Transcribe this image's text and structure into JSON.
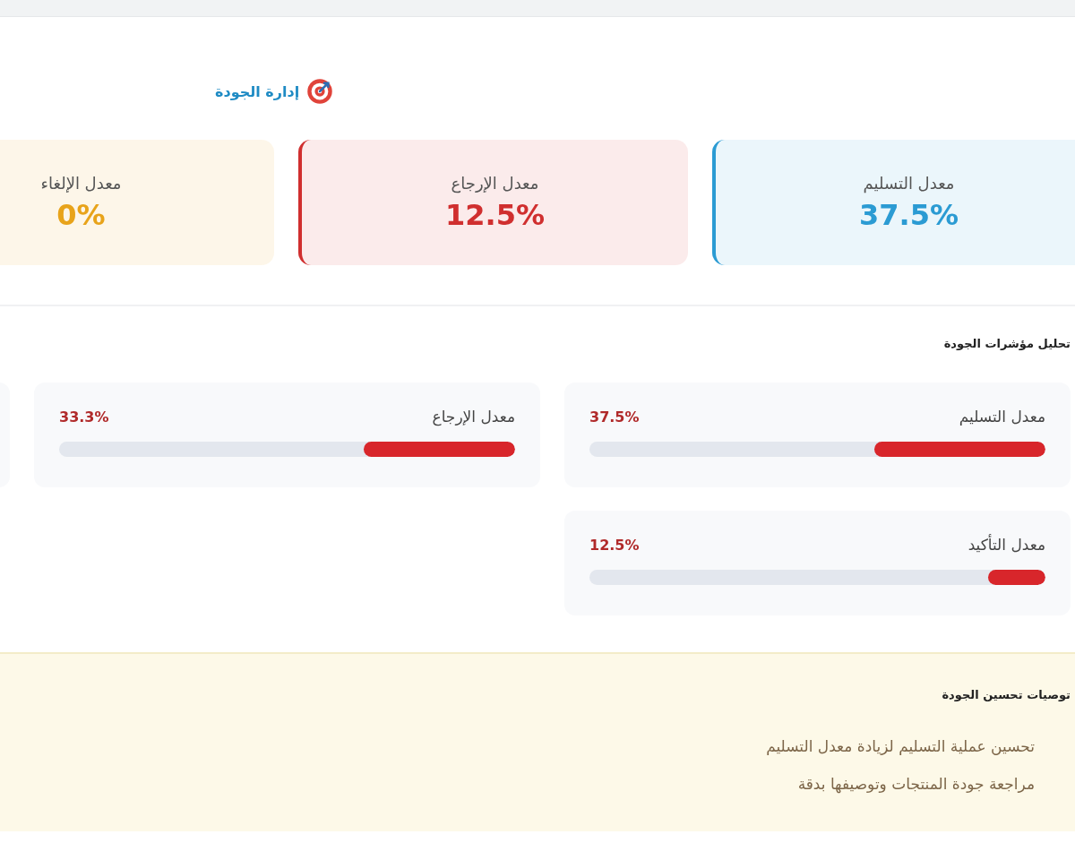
{
  "page_title": "إدارة الجودة",
  "summary_cards": [
    {
      "label": "معدل التسليم",
      "value": "37.5%",
      "color": "#2b9bd3"
    },
    {
      "label": "معدل الإرجاع",
      "value": "12.5%",
      "color": "#d02f2f"
    },
    {
      "label": "معدل الإلغاء",
      "value": "0%",
      "color": "#e8a31a"
    }
  ],
  "analysis": {
    "title": "تحليل مؤشرات الجودة",
    "metrics": [
      {
        "kind": "bar",
        "label": "معدل التسليم",
        "value": "37.5%",
        "level": 0.375
      },
      {
        "kind": "bar",
        "label": "معدل الإرجاع",
        "value": "33.3%",
        "level": 0.333
      },
      {
        "kind": "cut_off"
      },
      {
        "kind": "bar",
        "label": "معدل التأكيد",
        "value": "12.5%",
        "level": 0.125
      }
    ]
  },
  "recommendations": {
    "title": "توصيات تحسين الجودة",
    "items": [
      "تحسين عملية التسليم لزيادة معدل التسليم",
      "مراجعة جودة المنتجات وتوصيفها بدقة"
    ]
  }
}
